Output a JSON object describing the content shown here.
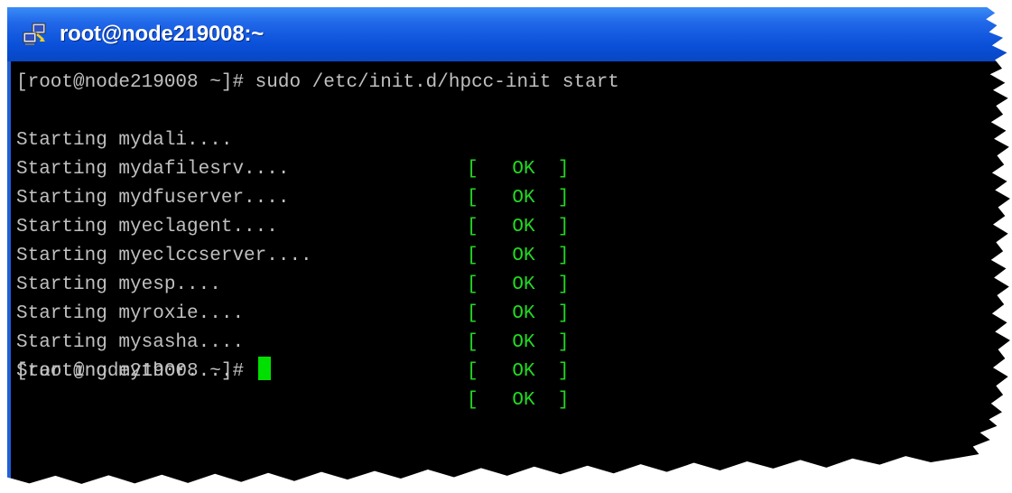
{
  "window": {
    "title": "root@node219008:~",
    "icon": "putty-computers-icon"
  },
  "terminal": {
    "command_line": "[root@node219008 ~]# sudo /etc/init.d/hpcc-init start",
    "services": [
      {
        "text": "Starting mydali....",
        "status": "[   OK  ]"
      },
      {
        "text": "Starting mydafilesrv....",
        "status": "[   OK  ]"
      },
      {
        "text": "Starting mydfuserver....",
        "status": "[   OK  ]"
      },
      {
        "text": "Starting myeclagent....",
        "status": "[   OK  ]"
      },
      {
        "text": "Starting myeclccserver....",
        "status": "[   OK  ]"
      },
      {
        "text": "Starting myesp....",
        "status": "[   OK  ]"
      },
      {
        "text": "Starting myroxie....",
        "status": "[   OK  ]"
      },
      {
        "text": "Starting mysasha....",
        "status": "[   OK  ]"
      },
      {
        "text": "Starting mythor....",
        "status": "[   OK  ]"
      }
    ],
    "prompt": "[root@node219008 ~]#",
    "colors": {
      "background": "#000000",
      "text": "#c0c0c0",
      "ok": "#22d822",
      "cursor": "#00e000",
      "titlebar": "#0a50d8"
    }
  }
}
